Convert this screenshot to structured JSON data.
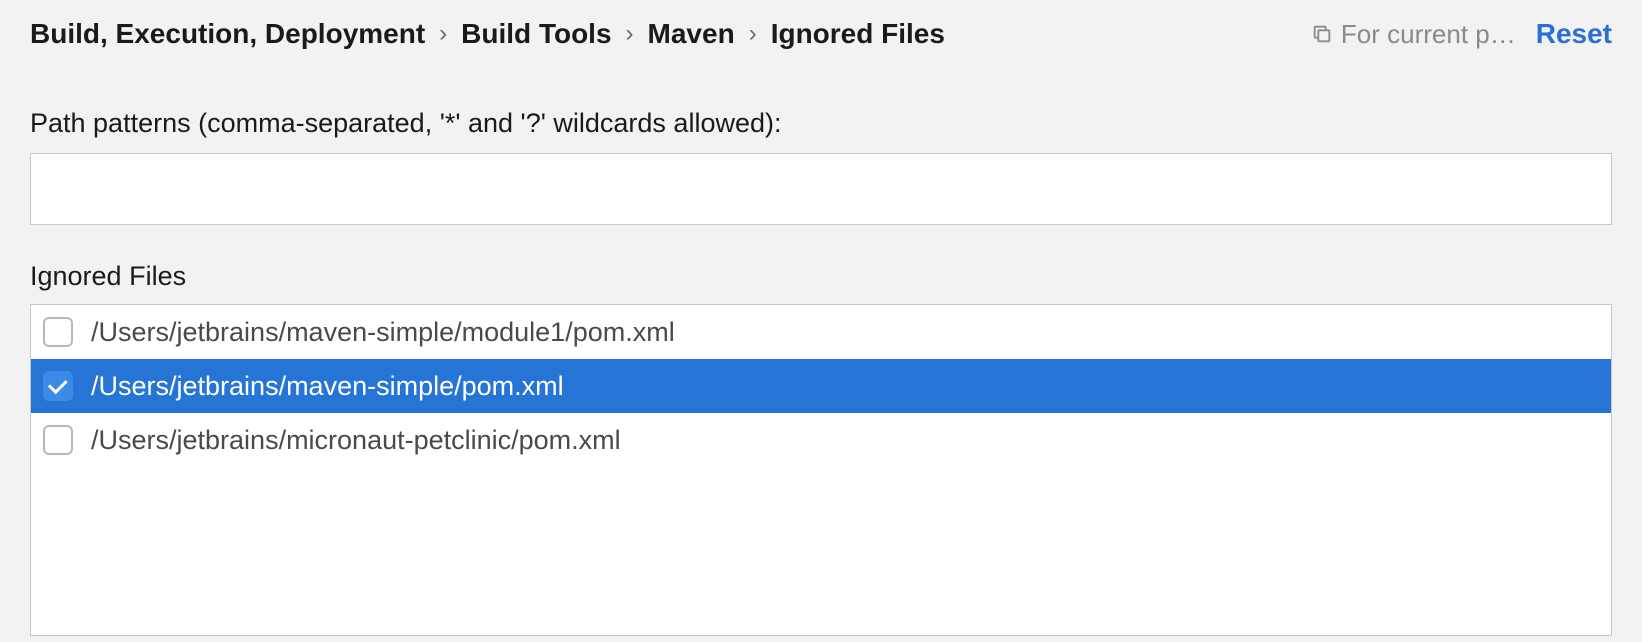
{
  "breadcrumb": {
    "items": [
      "Build, Execution, Deployment",
      "Build Tools",
      "Maven",
      "Ignored Files"
    ]
  },
  "header": {
    "scope_label": "For current p…",
    "reset_label": "Reset"
  },
  "patterns": {
    "label": "Path patterns (comma-separated, '*' and '?' wildcards allowed):",
    "value": ""
  },
  "ignored": {
    "label": "Ignored Files",
    "files": [
      {
        "path": "/Users/jetbrains/maven-simple/module1/pom.xml",
        "checked": false,
        "selected": false
      },
      {
        "path": "/Users/jetbrains/maven-simple/pom.xml",
        "checked": true,
        "selected": true
      },
      {
        "path": "/Users/jetbrains/micronaut-petclinic/pom.xml",
        "checked": false,
        "selected": false
      }
    ]
  }
}
